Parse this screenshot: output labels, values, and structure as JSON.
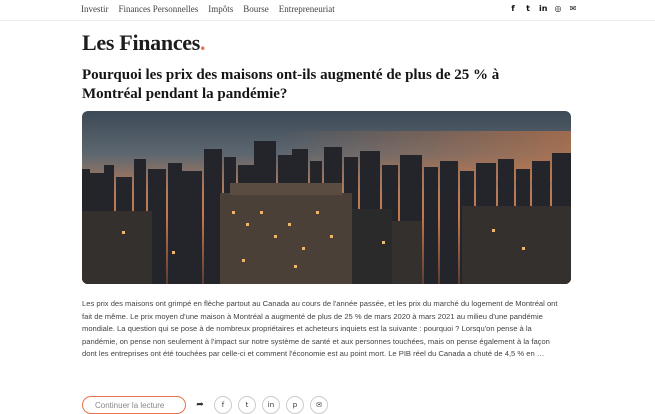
{
  "nav": {
    "items": [
      "Investir",
      "Finances Personnelles",
      "Impôts",
      "Bourse",
      "Entrepreneuriat"
    ]
  },
  "social": {
    "icons": [
      "facebook-icon",
      "twitter-icon",
      "linkedin-icon",
      "instagram-icon",
      "email-icon"
    ],
    "glyphs": [
      "f",
      "t",
      "in",
      "◎",
      "✉"
    ]
  },
  "logo": {
    "text": "Les Finances",
    "dot": "."
  },
  "article": {
    "title": "Pourquoi les prix des maisons ont-ils augmenté de plus de 25 % à Montréal pendant la pandémie?",
    "excerpt": "Les prix des maisons ont grimpé en flèche partout au Canada au cours de l'année passée, et les prix du marché du logement de Montréal ont fait de même. Le prix moyen d'une maison à Montréal a augmenté de plus de 25 % de mars 2020 à mars 2021 au milieu d'une pandémie mondiale. La question qui se pose à de nombreux propriétaires et acheteurs inquiets est la suivante : pourquoi ? Lorsqu'on pense à la pandémie, on pense non seulement à l'impact sur notre système de santé et aux personnes touchées, mais on pense également à la façon dont les entreprises ont été touchées par celle-ci et comment l'économie est au point mort. Le PIB réel du Canada a chuté de 4,5 % en …",
    "continue_label": "Continuer la lecture",
    "share_glyphs": [
      "➦",
      "f",
      "t",
      "in",
      "p",
      "✉"
    ]
  },
  "colors": {
    "accent": "#e8734a",
    "text": "#151515"
  }
}
